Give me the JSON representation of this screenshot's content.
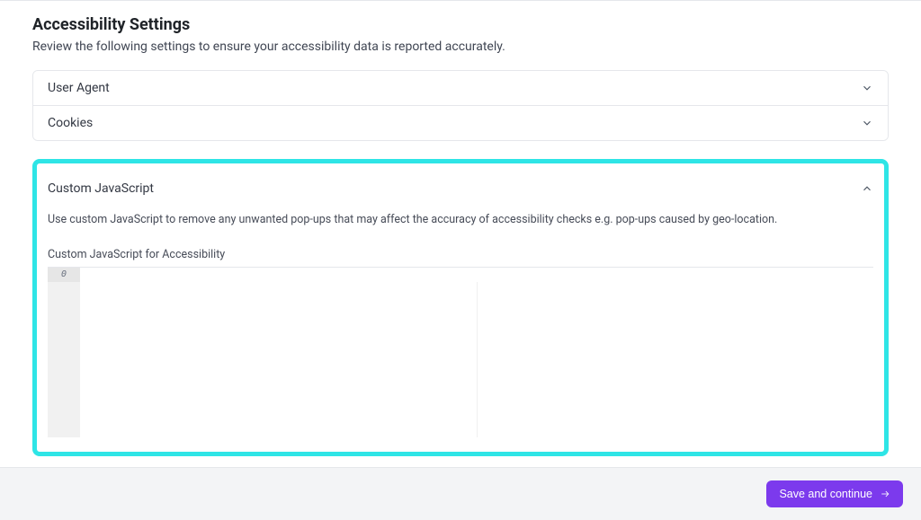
{
  "header": {
    "title": "Accessibility Settings",
    "subtitle": "Review the following settings to ensure your accessibility data is reported accurately."
  },
  "accordion": {
    "items": [
      {
        "label": "User Agent"
      },
      {
        "label": "Cookies"
      }
    ]
  },
  "custom_js": {
    "title": "Custom JavaScript",
    "description": "Use custom JavaScript to remove any unwanted pop-ups that may affect the accuracy of accessibility checks e.g. pop-ups caused by geo-location.",
    "field_label": "Custom JavaScript for Accessibility",
    "editor_tab": "0"
  },
  "footer": {
    "save_label": "Save and continue"
  }
}
